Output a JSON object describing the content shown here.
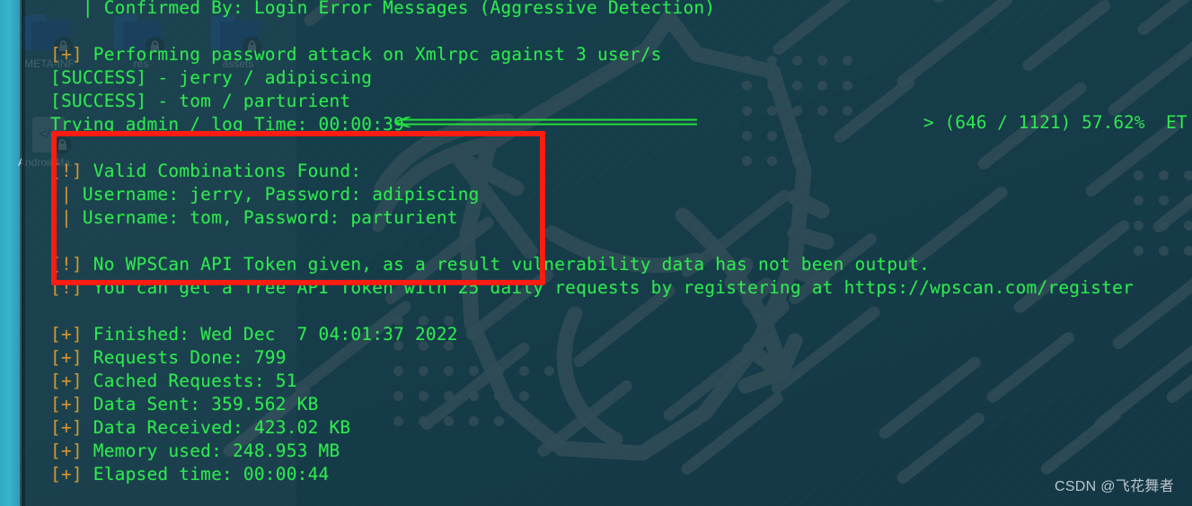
{
  "desktop": {
    "wallpaper_base_color": "#1d4753",
    "accent_gray": "#7d8082",
    "logo_name": "kali-dragon-logo"
  },
  "file_manager": {
    "edge_color": "#33aec7",
    "items": [
      {
        "label": "META-INF",
        "icon": "folder-locked-icon",
        "type": "folder"
      },
      {
        "label": "res",
        "icon": "folder-locked-icon",
        "type": "folder"
      },
      {
        "label": "assets",
        "icon": "folder-locked-icon",
        "type": "folder"
      },
      {
        "label": "AndroidMa...",
        "icon": "xml-file-locked-icon",
        "type": "file"
      }
    ]
  },
  "terminal": {
    "background_color": "#143a48",
    "text_color": "#2ee84f",
    "warn_color": "#d98c33",
    "lines": [
      {
        "indent": "   | ",
        "text": "Confirmed By: Login Error Messages (Aggressive Detection)"
      },
      {
        "indent": "",
        "text": ""
      },
      {
        "tag": "[+]",
        "tag_kind": "warn",
        "text": " Performing password attack on Xmlrpc against 3 user/s"
      },
      {
        "indent": "",
        "text": "[SUCCESS] - jerry / adipiscing"
      },
      {
        "indent": "",
        "text": "[SUCCESS] - tom / parturient"
      },
      {
        "indent": "",
        "text": "Trying admin / log Time: 00:00:39"
      },
      {
        "indent": "",
        "text": ""
      },
      {
        "tag": "[!]",
        "tag_kind": "warn",
        "text": " Valid Combinations Found:"
      },
      {
        "indent": " | ",
        "text": "Username: jerry, Password: adipiscing",
        "pipe": true
      },
      {
        "indent": " | ",
        "text": "Username: tom, Password: parturient",
        "pipe": true
      },
      {
        "indent": "",
        "text": ""
      },
      {
        "tag": "[!]",
        "tag_kind": "warn",
        "text": " No WPSCan API Token given, as a result vulnerability data has not been output."
      },
      {
        "tag": "[!]",
        "tag_kind": "warn",
        "text": " You can get a free API Token with 25 daily requests by registering at https://wpscan.com/register"
      },
      {
        "indent": "",
        "text": ""
      },
      {
        "tag": "[+]",
        "tag_kind": "warn",
        "text": " Finished: Wed Dec  7 04:01:37 2022"
      },
      {
        "tag": "[+]",
        "tag_kind": "warn",
        "text": " Requests Done: 799"
      },
      {
        "tag": "[+]",
        "tag_kind": "warn",
        "text": " Cached Requests: 51"
      },
      {
        "tag": "[+]",
        "tag_kind": "warn",
        "text": " Data Sent: 359.562 KB"
      },
      {
        "tag": "[+]",
        "tag_kind": "warn",
        "text": " Data Received: 423.02 KB"
      },
      {
        "tag": "[+]",
        "tag_kind": "warn",
        "text": " Memory used: 248.953 MB"
      },
      {
        "tag": "[+]",
        "tag_kind": "warn",
        "text": " Elapsed time: 00:00:44"
      }
    ],
    "progress": "> (646 / 1121) 57.62%  ET"
  },
  "annotations": {
    "box_color": "#fd1c12",
    "arrow_color": "#22dd3a",
    "box_name": "valid-combinations-highlight",
    "arrow_name": "progress-callout-arrow"
  },
  "watermark": {
    "text": "CSDN @飞花舞者"
  }
}
